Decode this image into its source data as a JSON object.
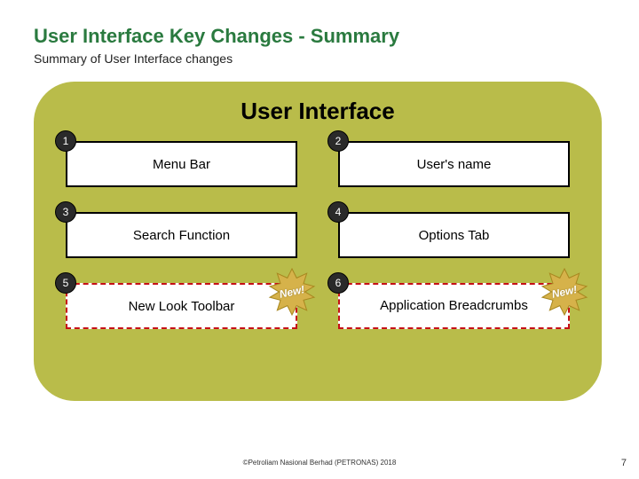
{
  "title_prefix": "User Interface Key Changes - ",
  "title_suffix": "Summary",
  "subtitle": "Summary of User Interface changes",
  "panel_title": "User Interface",
  "new_badge": "New!",
  "items": {
    "i1": {
      "num": "1",
      "label": "Menu Bar"
    },
    "i2": {
      "num": "2",
      "label": "User's name"
    },
    "i3": {
      "num": "3",
      "label": "Search Function"
    },
    "i4": {
      "num": "4",
      "label": "Options Tab"
    },
    "i5": {
      "num": "5",
      "label": "New Look Toolbar"
    },
    "i6": {
      "num": "6",
      "label": "Application Breadcrumbs"
    }
  },
  "footer": "©Petroliam Nasional Berhad (PETRONAS) 2018",
  "page_number": "7"
}
